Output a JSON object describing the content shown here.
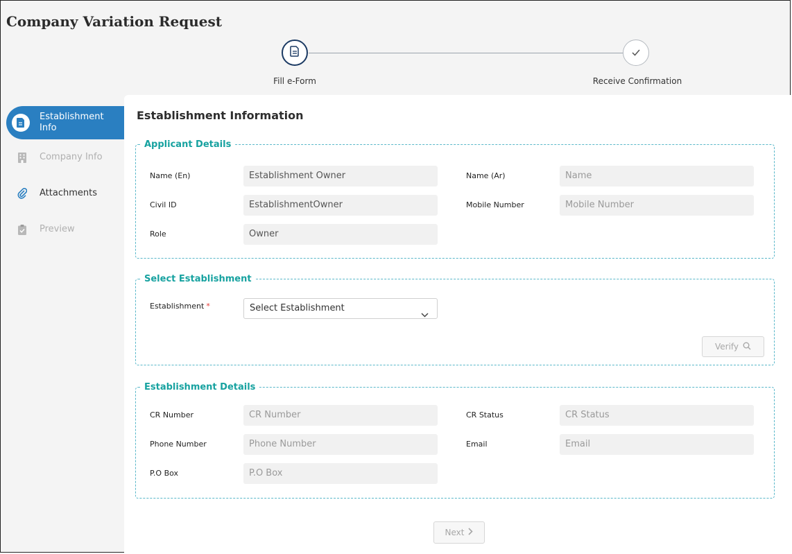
{
  "page": {
    "title": "Company Variation Request"
  },
  "stepper": {
    "steps": [
      {
        "label": "Fill e-Form",
        "icon": "document-icon",
        "state": "active"
      },
      {
        "label": "Receive Confirmation",
        "icon": "check-icon",
        "state": "pending"
      }
    ]
  },
  "sidebar": {
    "items": [
      {
        "label": "Establishment Info",
        "icon": "document-icon",
        "state": "active"
      },
      {
        "label": "Company Info",
        "icon": "building-icon",
        "state": "disabled"
      },
      {
        "label": "Attachments",
        "icon": "paperclip-icon",
        "state": "enabled"
      },
      {
        "label": "Preview",
        "icon": "clipboard-check-icon",
        "state": "disabled"
      }
    ]
  },
  "main": {
    "title": "Establishment Information",
    "applicant": {
      "legend": "Applicant Details",
      "name_en": {
        "label": "Name (En)",
        "value": "Establishment Owner"
      },
      "name_ar": {
        "label": "Name (Ar)",
        "placeholder": "Name"
      },
      "civil_id": {
        "label": "Civil ID",
        "value": "EstablishmentOwner"
      },
      "mobile": {
        "label": "Mobile Number",
        "placeholder": "Mobile Number"
      },
      "role": {
        "label": "Role",
        "value": "Owner"
      }
    },
    "select_establishment": {
      "legend": "Select Establishment",
      "label": "Establishment",
      "required_mark": "*",
      "selected": "Select Establishment",
      "verify_label": "Verify"
    },
    "establishment_details": {
      "legend": "Establishment Details",
      "cr_number": {
        "label": "CR Number",
        "placeholder": "CR Number"
      },
      "cr_status": {
        "label": "CR Status",
        "placeholder": "CR Status"
      },
      "phone": {
        "label": "Phone Number",
        "placeholder": "Phone Number"
      },
      "email": {
        "label": "Email",
        "placeholder": "Email"
      },
      "po_box": {
        "label": "P.O Box",
        "placeholder": "P.O Box"
      }
    },
    "next_label": "Next"
  },
  "colors": {
    "accent_blue": "#2a7fc1",
    "teal": "#17a2a0",
    "stepper_navy": "#1b3a63",
    "required_red": "#e53935"
  }
}
